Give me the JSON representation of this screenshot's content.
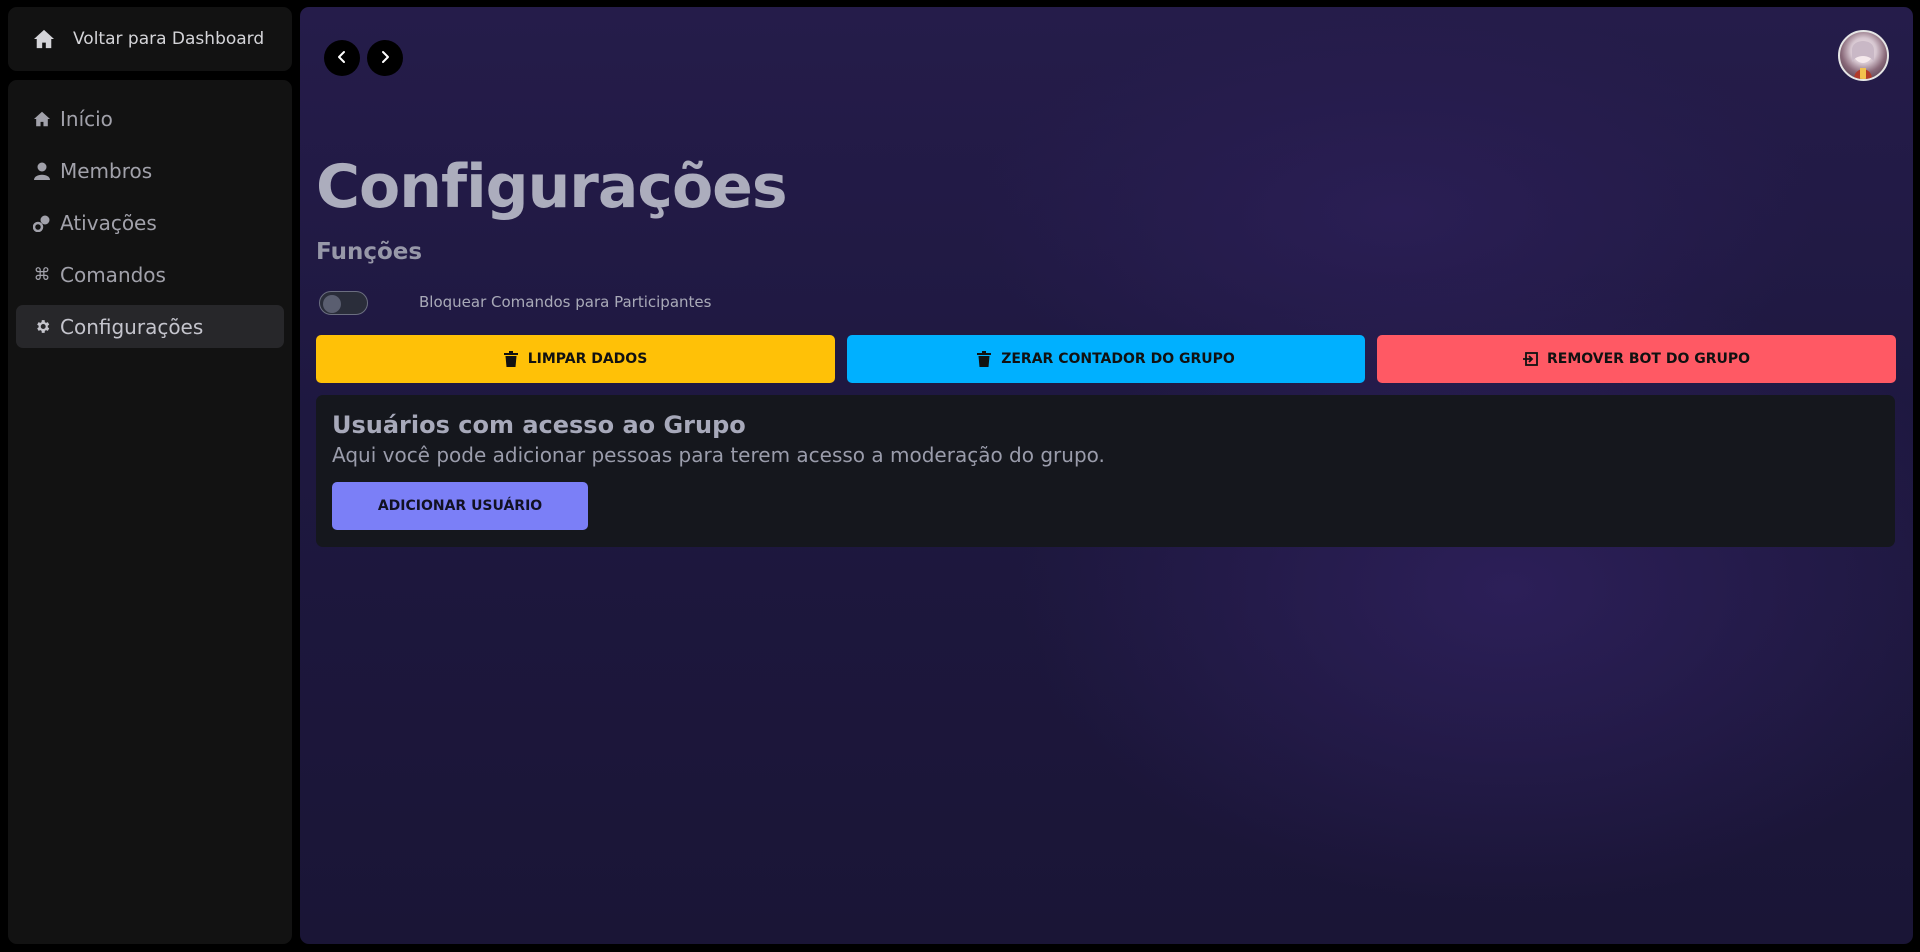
{
  "sidebar": {
    "back_label": "Voltar para Dashboard",
    "items": [
      {
        "label": "Início",
        "icon": "home-icon",
        "active": false
      },
      {
        "label": "Membros",
        "icon": "user-icon",
        "active": false
      },
      {
        "label": "Ativações",
        "icon": "link-icon",
        "active": false
      },
      {
        "label": "Comandos",
        "icon": "command-icon",
        "active": false
      },
      {
        "label": "Configurações",
        "icon": "gear-icon",
        "active": true
      }
    ]
  },
  "header": {
    "back_icon": "chevron-left-icon",
    "forward_icon": "chevron-right-icon",
    "avatar": "user-avatar"
  },
  "main": {
    "title": "Configurações",
    "subtitle": "Funções",
    "toggle": {
      "label": "Bloquear Comandos para Participantes",
      "checked": false
    },
    "actions": [
      {
        "label": "LIMPAR DADOS",
        "icon": "trash-icon",
        "color": "#ffc107"
      },
      {
        "label": "ZERAR CONTADOR DO GRUPO",
        "icon": "trash-icon",
        "color": "#00b0ff"
      },
      {
        "label": "REMOVER BOT DO GRUPO",
        "icon": "exit-icon",
        "color": "#ff5964"
      }
    ],
    "access_card": {
      "title": "Usuários com acesso ao Grupo",
      "description": "Aqui você pode adicionar pessoas para terem acesso a moderação do grupo.",
      "button_label": "ADICIONAR USUÁRIO"
    }
  },
  "colors": {
    "accent": "#7b7ff7",
    "sidebar_bg": "#121212",
    "main_bg": "#1e1840"
  }
}
